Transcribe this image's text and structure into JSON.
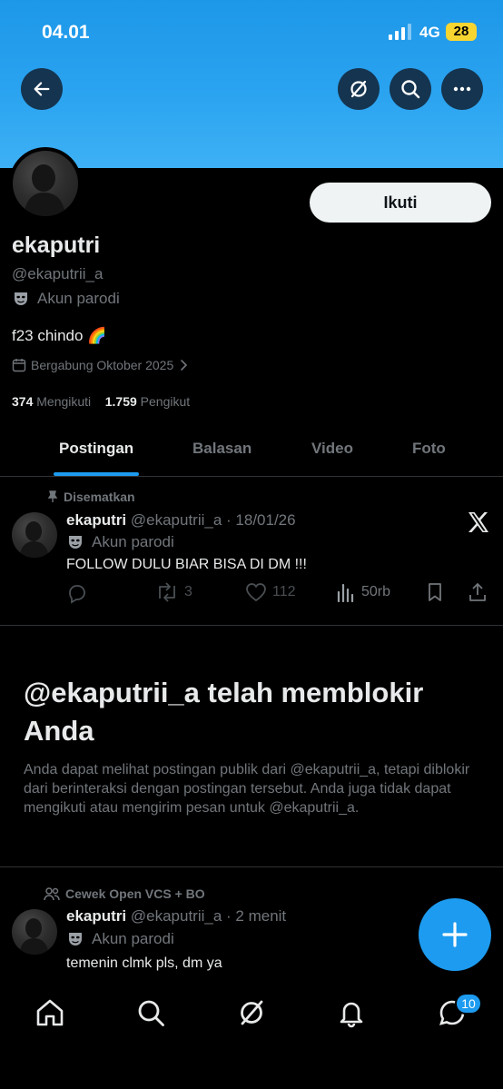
{
  "status_bar": {
    "time": "04.01",
    "network": "4G",
    "battery": "28"
  },
  "profile": {
    "name": "ekaputri",
    "handle": "@ekaputrii_a",
    "parody_label": "Akun parodi",
    "bio": "f23 chindo 🌈",
    "joined": "Bergabung Oktober 2025",
    "following_count": "374",
    "following_label": "Mengikuti",
    "followers_count": "1.759",
    "followers_label": "Pengikut",
    "follow_button": "Ikuti"
  },
  "tabs": [
    {
      "label": "Postingan",
      "active": true
    },
    {
      "label": "Balasan",
      "active": false
    },
    {
      "label": "Video",
      "active": false
    },
    {
      "label": "Foto",
      "active": false
    }
  ],
  "pinned_post": {
    "pinned_label": "Disematkan",
    "author": "ekaputri",
    "meta": "@ekaputrii_a · 18/01/26",
    "parody_label": "Akun parodi",
    "text": "FOLLOW DULU BIAR BISA DI DM !!!",
    "reposts": "3",
    "likes": "112",
    "views": "50rb"
  },
  "block_notice": {
    "title": "@ekaputrii_a telah memblokir Anda",
    "description": "Anda dapat melihat postingan publik dari @ekaputrii_a, tetapi diblokir dari berinteraksi dengan postingan tersebut. Anda juga tidak dapat mengikuti atau mengirim pesan untuk @ekaputrii_a."
  },
  "community_post": {
    "community_label": "Cewek Open VCS + BO",
    "author": "ekaputri",
    "meta": "@ekaputrii_a · 2 menit",
    "parody_label": "Akun parodi",
    "text": "temenin clmk pls, dm ya"
  },
  "bottom_nav": {
    "messages_badge": "10"
  },
  "colors": {
    "accent": "#1d9bf0",
    "banner": "#2aa3f0",
    "background": "#000000",
    "muted": "#71767b"
  }
}
